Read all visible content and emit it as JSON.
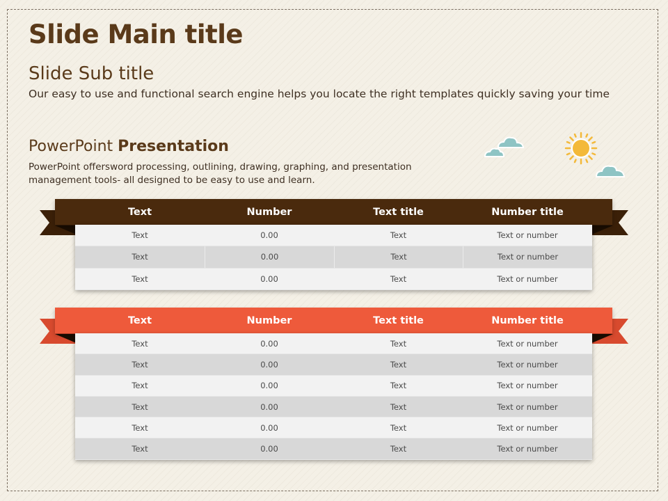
{
  "slide": {
    "main_title": "Slide Main title",
    "sub_title": "Slide Sub title",
    "sub_description": "Our easy to use and functional search engine helps you locate the right templates quickly saving your time",
    "section_title_regular": "PowerPoint ",
    "section_title_bold": "Presentation",
    "section_description": "PowerPoint offersword processing, outlining, drawing, graphing, and presentation management tools- all designed to be easy to use and learn."
  },
  "colors": {
    "brown": "#4a2a0d",
    "orange": "#ee5a3b",
    "title_text": "#5a3a1a",
    "sun": "#f3b93a",
    "cloud": "#8ec4c4"
  },
  "icons": [
    "cloud-icon",
    "sun-icon"
  ],
  "table1": {
    "headers": [
      "Text",
      "Number",
      "Text title",
      "Number title"
    ],
    "rows": [
      [
        "Text",
        "0.00",
        "Text",
        "Text or number"
      ],
      [
        "Text",
        "0.00",
        "Text",
        "Text or number"
      ],
      [
        "Text",
        "0.00",
        "Text",
        "Text or number"
      ]
    ]
  },
  "table2": {
    "headers": [
      "Text",
      "Number",
      "Text title",
      "Number title"
    ],
    "rows": [
      [
        "Text",
        "0.00",
        "Text",
        "Text or number"
      ],
      [
        "Text",
        "0.00",
        "Text",
        "Text or number"
      ],
      [
        "Text",
        "0.00",
        "Text",
        "Text or number"
      ],
      [
        "Text",
        "0.00",
        "Text",
        "Text or number"
      ],
      [
        "Text",
        "0.00",
        "Text",
        "Text or number"
      ],
      [
        "Text",
        "0.00",
        "Text",
        "Text or number"
      ]
    ]
  }
}
